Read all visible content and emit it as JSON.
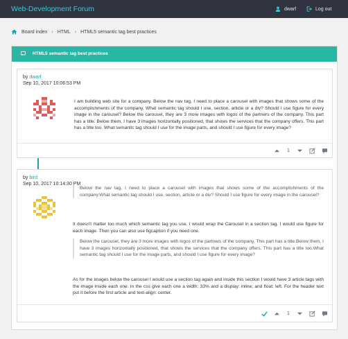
{
  "topbar": {
    "brand": "Web-Development Forum",
    "user": "dwarf",
    "logout": "Log out"
  },
  "breadcrumb": {
    "items": [
      "Board index",
      "HTML",
      "HTML5 semantic tag best practices"
    ]
  },
  "topic": {
    "title": "HTML5 semantic tag best practices"
  },
  "posts": [
    {
      "by": "by",
      "author": "dwarf",
      "date": "Sep 10, 2017 10:06:53 PM",
      "body": "I am building web site for a company. Below the nav tag, I need to place a carousel with images that shows some of the accomplishments of the company. What semantic tag should I use, section, article or a div? Should I use figure for every image in the carousel? Below the carousel, they are 3 more images with logos of the partners of the company. This part has a title. Below them, I have 3 images horizontally positioned, that shows the services that the company offers. This part has a title too. What semantic tag should I use for the image parts, and should I use figure for every image?",
      "votes": "1"
    },
    {
      "by": "by",
      "author": "bird",
      "date": "Sep 10, 2017 10:14:30 PM",
      "quote1": "Below the nav tag, I need to place a carousel with images that shows some of the accomplishments of the company.What semantic tag should I use, section, article or a div? Should I use figure for every image in the carousel?",
      "para1": "It doesn't matter too much which semantic tag you use. I would wrap the Carousel in a section tag. I would use figure for each image. Then you can also use figcaption if you need one.",
      "quote2": "Below the carousel, they are 3 more images with logos of the partners of the company. This part has a title.Below them, I have 3 images horizontally positioned, that shows the services that the company offers. This part has a title too.What semantic tag should I use for the image parts, and should I use figure for every image?",
      "para2": "As for the images below the carousel I would use a section tag again and inside this section I would have 3 article tags with the image inside each one. In the css give each one a width: 33% and a display: inline; and float: left. For the header text put it before the first article and text-align: center.",
      "votes": "1"
    }
  ],
  "colors": {
    "topbar": "#2f3440",
    "brand": "#3fc6d6",
    "accent": "#27b7a4",
    "link": "#14a4b8",
    "avatar_dwarf": "#e05a5a",
    "avatar_bird": "#e8c43a"
  },
  "icons": {
    "user": "user-icon",
    "logout": "logout-icon",
    "home": "home-icon",
    "topic": "comment-icon",
    "upvote": "caret-up-icon",
    "downvote": "caret-down-icon",
    "edit": "edit-icon",
    "reply": "reply-icon",
    "accepted": "check-icon"
  }
}
